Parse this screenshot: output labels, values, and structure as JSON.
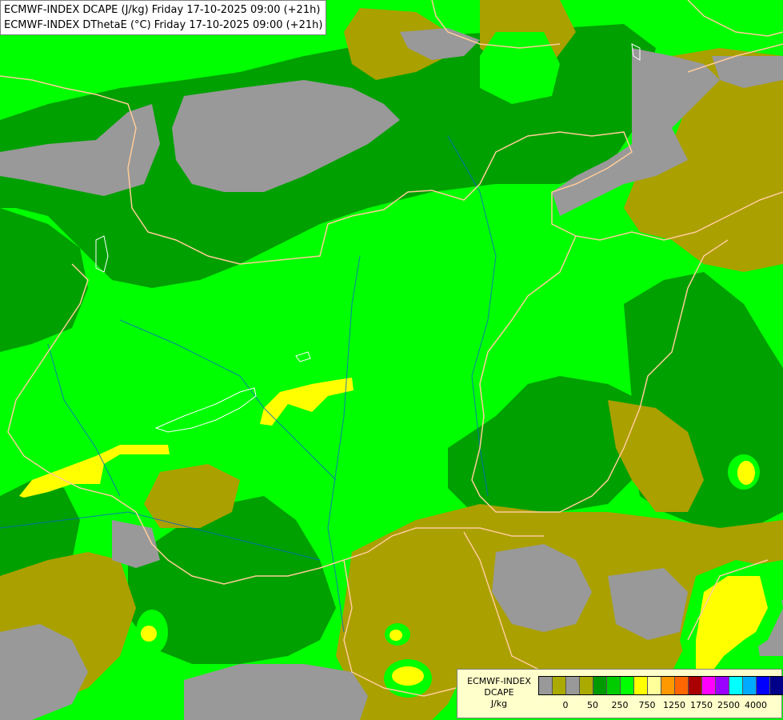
{
  "title": {
    "line1": "ECMWF-INDEX DCAPE (J/kg) Friday 17-10-2025 09:00 (+21h)",
    "line2": "ECMWF-INDEX DThetaE (°C) Friday 17-10-2025 09:00 (+21h)"
  },
  "legend": {
    "model": "ECMWF-INDEX",
    "parameter": "DCAPE",
    "unit": "J/kg",
    "colors": [
      "#999999",
      "#aaaa00",
      "#999999",
      "#aaaa00",
      "#009900",
      "#00cc00",
      "#00ff00",
      "#ffff00",
      "#ffff99",
      "#ff9900",
      "#ff6600",
      "#aa0000",
      "#ff00ff",
      "#9900ff",
      "#00ffff",
      "#00aaff",
      "#0000ff",
      "#000088"
    ],
    "tick_labels": [
      "0",
      "50",
      "250",
      "750",
      "1250",
      "1750",
      "2500",
      "4000"
    ]
  },
  "colors": {
    "gray": "#999999",
    "olive": "#aaa000",
    "dark_green": "#009900",
    "green": "#00ff00",
    "yellow": "#ffff00",
    "borders": "#ffcc99",
    "rivers": "#0066cc"
  }
}
